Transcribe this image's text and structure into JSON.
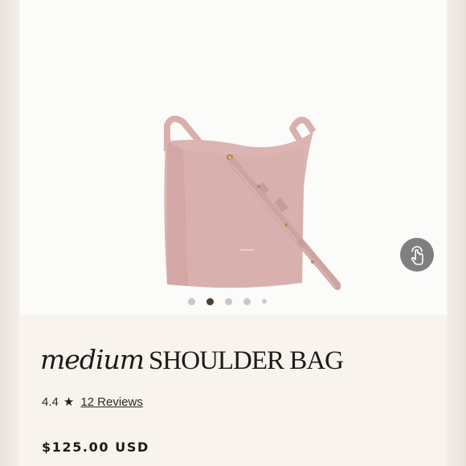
{
  "product": {
    "title_script": "medium",
    "title_caps": "SHOULDER BAG",
    "rating": "4.4",
    "star": "★",
    "reviews_link": "12 Reviews",
    "price": "$125.00 USD"
  },
  "gallery": {
    "image_count": 5,
    "active_index": 1,
    "bag_color": "#dcb4b2",
    "touch_icon": "tap-gesture-icon"
  }
}
